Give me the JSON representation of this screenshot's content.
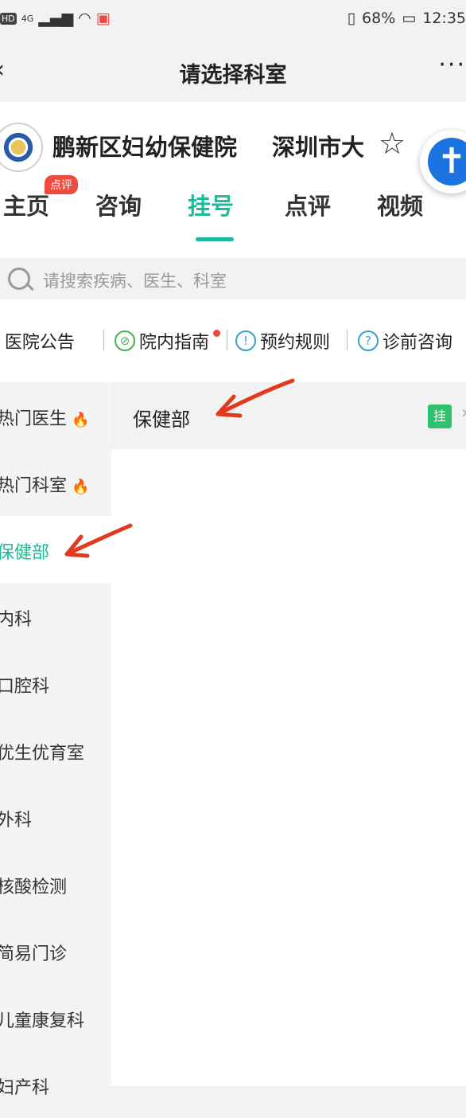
{
  "status_bar": {
    "network": "4G",
    "battery": "68%",
    "time": "12:35"
  },
  "nav": {
    "title": "请选择科室"
  },
  "hospital": {
    "name": "鹏新区妇幼保健院",
    "name_2": "深圳市大",
    "tabs": [
      {
        "label": "主页"
      },
      {
        "label": "咨询"
      },
      {
        "label": "挂号"
      },
      {
        "label": "点评"
      },
      {
        "label": "视频"
      }
    ],
    "tab_badge": "点评"
  },
  "search": {
    "placeholder": "请搜索疾病、医生、科室"
  },
  "quick_links": [
    {
      "label": "医院公告",
      "icon": "speaker-icon"
    },
    {
      "label": "院内指南",
      "icon": "compass-icon"
    },
    {
      "label": "预约规则",
      "icon": "info-icon"
    },
    {
      "label": "诊前咨询",
      "icon": "question-icon"
    }
  ],
  "departments": [
    {
      "label": "热门医生"
    },
    {
      "label": "热门科室"
    },
    {
      "label": "保健部"
    },
    {
      "label": "内科"
    },
    {
      "label": "口腔科"
    },
    {
      "label": "优生优育室"
    },
    {
      "label": "外科"
    },
    {
      "label": "核酸检测"
    },
    {
      "label": "简易门诊"
    },
    {
      "label": "儿童康复科"
    },
    {
      "label": "妇产科"
    }
  ],
  "selected_department": {
    "name": "保健部",
    "badge": "挂"
  },
  "colors": {
    "accent": "#1abc9c",
    "badge_red": "#ef4b3f",
    "register_green": "#2fc26e",
    "annotation_arrow": "#e03a1f"
  }
}
